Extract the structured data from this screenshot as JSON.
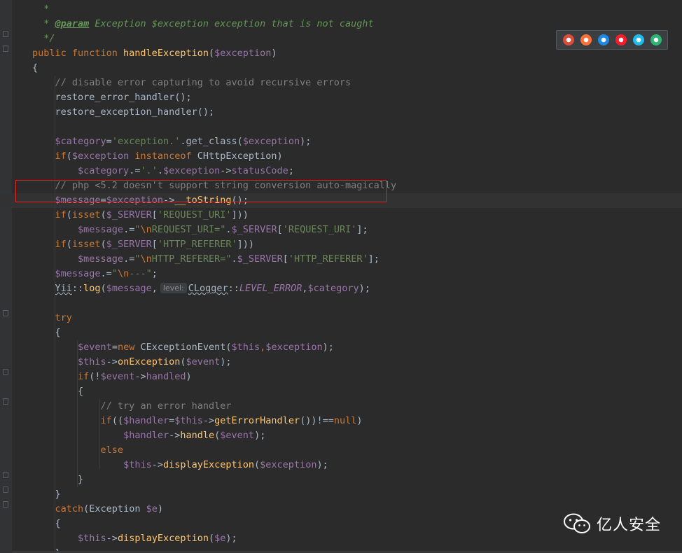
{
  "code": {
    "lines": [
      {
        "indent": "  ",
        "parts": [
          {
            "t": "*",
            "c": "doc"
          }
        ]
      },
      {
        "indent": "  ",
        "parts": [
          {
            "t": "* ",
            "c": "doc"
          },
          {
            "t": "@param",
            "c": "doctag"
          },
          {
            "t": " Exception $exception exception that is not caught",
            "c": "doc"
          }
        ]
      },
      {
        "indent": "  ",
        "parts": [
          {
            "t": "*/",
            "c": "doc"
          }
        ]
      },
      {
        "indent": "",
        "parts": [
          {
            "t": "public function ",
            "c": "kw"
          },
          {
            "t": "handleException",
            "c": "fn"
          },
          {
            "t": "(",
            "c": ""
          },
          {
            "t": "$exception",
            "c": "var"
          },
          {
            "t": ")",
            "c": ""
          }
        ]
      },
      {
        "indent": "",
        "parts": [
          {
            "t": "{",
            "c": ""
          }
        ]
      },
      {
        "indent": "    ",
        "parts": [
          {
            "t": "// disable error capturing to avoid recursive errors",
            "c": "cm"
          }
        ]
      },
      {
        "indent": "    ",
        "parts": [
          {
            "t": "restore_error_handler",
            "c": ""
          },
          {
            "t": "();",
            "c": ""
          }
        ]
      },
      {
        "indent": "    ",
        "parts": [
          {
            "t": "restore_exception_handler",
            "c": ""
          },
          {
            "t": "();",
            "c": ""
          }
        ]
      },
      {
        "indent": "",
        "parts": []
      },
      {
        "indent": "    ",
        "parts": [
          {
            "t": "$category",
            "c": "var"
          },
          {
            "t": "=",
            "c": ""
          },
          {
            "t": "'exception.'",
            "c": "str"
          },
          {
            "t": ".",
            "c": ""
          },
          {
            "t": "get_class",
            "c": ""
          },
          {
            "t": "(",
            "c": ""
          },
          {
            "t": "$exception",
            "c": "var"
          },
          {
            "t": ");",
            "c": ""
          }
        ]
      },
      {
        "indent": "    ",
        "parts": [
          {
            "t": "if",
            "c": "kw"
          },
          {
            "t": "(",
            "c": ""
          },
          {
            "t": "$exception",
            "c": "var"
          },
          {
            "t": " instanceof ",
            "c": "kw"
          },
          {
            "t": "CHttpException",
            "c": "cls"
          },
          {
            "t": ")",
            "c": ""
          }
        ]
      },
      {
        "indent": "        ",
        "parts": [
          {
            "t": "$category",
            "c": "var"
          },
          {
            "t": ".=",
            "c": ""
          },
          {
            "t": "'.'",
            "c": "str"
          },
          {
            "t": ".",
            "c": ""
          },
          {
            "t": "$exception",
            "c": "var"
          },
          {
            "t": "->",
            "c": ""
          },
          {
            "t": "statusCode",
            "c": "var"
          },
          {
            "t": ";",
            "c": ""
          }
        ]
      },
      {
        "indent": "    ",
        "parts": [
          {
            "t": "// php <5.2 doesn't support string conversion auto-magically",
            "c": "cm"
          }
        ]
      },
      {
        "indent": "    ",
        "parts": [
          {
            "t": "$message",
            "c": "var"
          },
          {
            "t": "=",
            "c": ""
          },
          {
            "t": "$exception",
            "c": "var"
          },
          {
            "t": "->",
            "c": ""
          },
          {
            "t": "__toString",
            "c": "fn"
          },
          {
            "t": "();",
            "c": ""
          }
        ],
        "current": true
      },
      {
        "indent": "    ",
        "parts": [
          {
            "t": "if",
            "c": "kw"
          },
          {
            "t": "(",
            "c": ""
          },
          {
            "t": "isset",
            "c": "kw"
          },
          {
            "t": "(",
            "c": ""
          },
          {
            "t": "$_SERVER",
            "c": "var"
          },
          {
            "t": "[",
            "c": ""
          },
          {
            "t": "'REQUEST_URI'",
            "c": "str"
          },
          {
            "t": "]))",
            "c": ""
          }
        ]
      },
      {
        "indent": "        ",
        "parts": [
          {
            "t": "$message",
            "c": "var"
          },
          {
            "t": ".=",
            "c": ""
          },
          {
            "t": "\"",
            "c": "str"
          },
          {
            "t": "\\n",
            "c": "esc"
          },
          {
            "t": "REQUEST_URI=\"",
            "c": "str"
          },
          {
            "t": ".",
            "c": ""
          },
          {
            "t": "$_SERVER",
            "c": "var"
          },
          {
            "t": "[",
            "c": ""
          },
          {
            "t": "'REQUEST_URI'",
            "c": "str"
          },
          {
            "t": "];",
            "c": ""
          }
        ]
      },
      {
        "indent": "    ",
        "parts": [
          {
            "t": "if",
            "c": "kw"
          },
          {
            "t": "(",
            "c": ""
          },
          {
            "t": "isset",
            "c": "kw"
          },
          {
            "t": "(",
            "c": ""
          },
          {
            "t": "$_SERVER",
            "c": "var"
          },
          {
            "t": "[",
            "c": ""
          },
          {
            "t": "'HTTP_REFERER'",
            "c": "str"
          },
          {
            "t": "]))",
            "c": ""
          }
        ]
      },
      {
        "indent": "        ",
        "parts": [
          {
            "t": "$message",
            "c": "var"
          },
          {
            "t": ".=",
            "c": ""
          },
          {
            "t": "\"",
            "c": "str"
          },
          {
            "t": "\\n",
            "c": "esc"
          },
          {
            "t": "HTTP_REFERER=\"",
            "c": "str"
          },
          {
            "t": ".",
            "c": ""
          },
          {
            "t": "$_SERVER",
            "c": "var"
          },
          {
            "t": "[",
            "c": ""
          },
          {
            "t": "'HTTP_REFERER'",
            "c": "str"
          },
          {
            "t": "];",
            "c": ""
          }
        ]
      },
      {
        "indent": "    ",
        "parts": [
          {
            "t": "$message",
            "c": "var"
          },
          {
            "t": ".=",
            "c": ""
          },
          {
            "t": "\"",
            "c": "str"
          },
          {
            "t": "\\n",
            "c": "esc"
          },
          {
            "t": "---\"",
            "c": "str"
          },
          {
            "t": ";",
            "c": ""
          }
        ]
      },
      {
        "indent": "    ",
        "parts": [
          {
            "t": "Yii",
            "c": "wavy"
          },
          {
            "t": "::",
            "c": ""
          },
          {
            "t": "log",
            "c": "fn"
          },
          {
            "t": "(",
            "c": ""
          },
          {
            "t": "$message",
            "c": "var"
          },
          {
            "t": ",",
            "c": ""
          },
          {
            "t": "level:",
            "c": "hint"
          },
          {
            "t": "CLogger",
            "c": "wavy"
          },
          {
            "t": "::",
            "c": ""
          },
          {
            "t": "LEVEL_ERROR",
            "c": "const"
          },
          {
            "t": ",",
            "c": ""
          },
          {
            "t": "$category",
            "c": "var"
          },
          {
            "t": ");",
            "c": ""
          }
        ]
      },
      {
        "indent": "",
        "parts": []
      },
      {
        "indent": "    ",
        "parts": [
          {
            "t": "try",
            "c": "kw"
          }
        ]
      },
      {
        "indent": "    ",
        "parts": [
          {
            "t": "{",
            "c": ""
          }
        ]
      },
      {
        "indent": "        ",
        "parts": [
          {
            "t": "$event",
            "c": "var"
          },
          {
            "t": "=",
            "c": ""
          },
          {
            "t": "new ",
            "c": "kw"
          },
          {
            "t": "CExceptionEvent",
            "c": "cls"
          },
          {
            "t": "(",
            "c": ""
          },
          {
            "t": "$this",
            "c": "var"
          },
          {
            "t": ",",
            "c": "kw"
          },
          {
            "t": "$exception",
            "c": "var"
          },
          {
            "t": ");",
            "c": ""
          }
        ]
      },
      {
        "indent": "        ",
        "parts": [
          {
            "t": "$this",
            "c": "var"
          },
          {
            "t": "->",
            "c": ""
          },
          {
            "t": "onException",
            "c": "fn"
          },
          {
            "t": "(",
            "c": ""
          },
          {
            "t": "$event",
            "c": "var"
          },
          {
            "t": ");",
            "c": ""
          }
        ]
      },
      {
        "indent": "        ",
        "parts": [
          {
            "t": "if",
            "c": "kw"
          },
          {
            "t": "(!",
            "c": ""
          },
          {
            "t": "$event",
            "c": "var"
          },
          {
            "t": "->",
            "c": ""
          },
          {
            "t": "handled",
            "c": "var"
          },
          {
            "t": ")",
            "c": ""
          }
        ]
      },
      {
        "indent": "        ",
        "parts": [
          {
            "t": "{",
            "c": ""
          }
        ]
      },
      {
        "indent": "            ",
        "parts": [
          {
            "t": "// try an error handler",
            "c": "cm"
          }
        ]
      },
      {
        "indent": "            ",
        "parts": [
          {
            "t": "if",
            "c": "kw"
          },
          {
            "t": "((",
            "c": ""
          },
          {
            "t": "$handler",
            "c": "var"
          },
          {
            "t": "=",
            "c": ""
          },
          {
            "t": "$this",
            "c": "var"
          },
          {
            "t": "->",
            "c": ""
          },
          {
            "t": "getErrorHandler",
            "c": "fn"
          },
          {
            "t": "())!==",
            "c": ""
          },
          {
            "t": "null",
            "c": "kw"
          },
          {
            "t": ")",
            "c": ""
          }
        ]
      },
      {
        "indent": "                ",
        "parts": [
          {
            "t": "$handler",
            "c": "var"
          },
          {
            "t": "->",
            "c": ""
          },
          {
            "t": "handle",
            "c": "fn"
          },
          {
            "t": "(",
            "c": ""
          },
          {
            "t": "$event",
            "c": "var"
          },
          {
            "t": ");",
            "c": ""
          }
        ]
      },
      {
        "indent": "            ",
        "parts": [
          {
            "t": "else",
            "c": "kw"
          }
        ]
      },
      {
        "indent": "                ",
        "parts": [
          {
            "t": "$this",
            "c": "var"
          },
          {
            "t": "->",
            "c": ""
          },
          {
            "t": "displayException",
            "c": "fn"
          },
          {
            "t": "(",
            "c": ""
          },
          {
            "t": "$exception",
            "c": "var"
          },
          {
            "t": ");",
            "c": ""
          }
        ]
      },
      {
        "indent": "        ",
        "parts": [
          {
            "t": "}",
            "c": ""
          }
        ]
      },
      {
        "indent": "    ",
        "parts": [
          {
            "t": "}",
            "c": ""
          }
        ]
      },
      {
        "indent": "    ",
        "parts": [
          {
            "t": "catch",
            "c": "kw"
          },
          {
            "t": "(",
            "c": ""
          },
          {
            "t": "Exception ",
            "c": "cls"
          },
          {
            "t": "$e",
            "c": "var"
          },
          {
            "t": ")",
            "c": ""
          }
        ]
      },
      {
        "indent": "    ",
        "parts": [
          {
            "t": "{",
            "c": ""
          }
        ]
      },
      {
        "indent": "        ",
        "parts": [
          {
            "t": "$this",
            "c": "var"
          },
          {
            "t": "->",
            "c": ""
          },
          {
            "t": "displayException",
            "c": "fn"
          },
          {
            "t": "(",
            "c": ""
          },
          {
            "t": "$e",
            "c": "var"
          },
          {
            "t": ");",
            "c": ""
          }
        ]
      },
      {
        "indent": "    ",
        "parts": [
          {
            "t": "}",
            "c": ""
          }
        ]
      }
    ]
  },
  "browser_icons": [
    {
      "name": "chrome-icon",
      "color": "#dd4b39"
    },
    {
      "name": "firefox-icon",
      "color": "#ff7139"
    },
    {
      "name": "safari-icon",
      "color": "#1e88e5"
    },
    {
      "name": "opera-icon",
      "color": "#ff1b2d"
    },
    {
      "name": "ie-icon",
      "color": "#1ebbee"
    },
    {
      "name": "edge-icon",
      "color": "#2bb673"
    }
  ],
  "watermark": {
    "text": "亿人安全",
    "icon": "wechat-icon"
  },
  "colors": {
    "background": "#2b2b2b",
    "highlight_box": "#e02424"
  }
}
